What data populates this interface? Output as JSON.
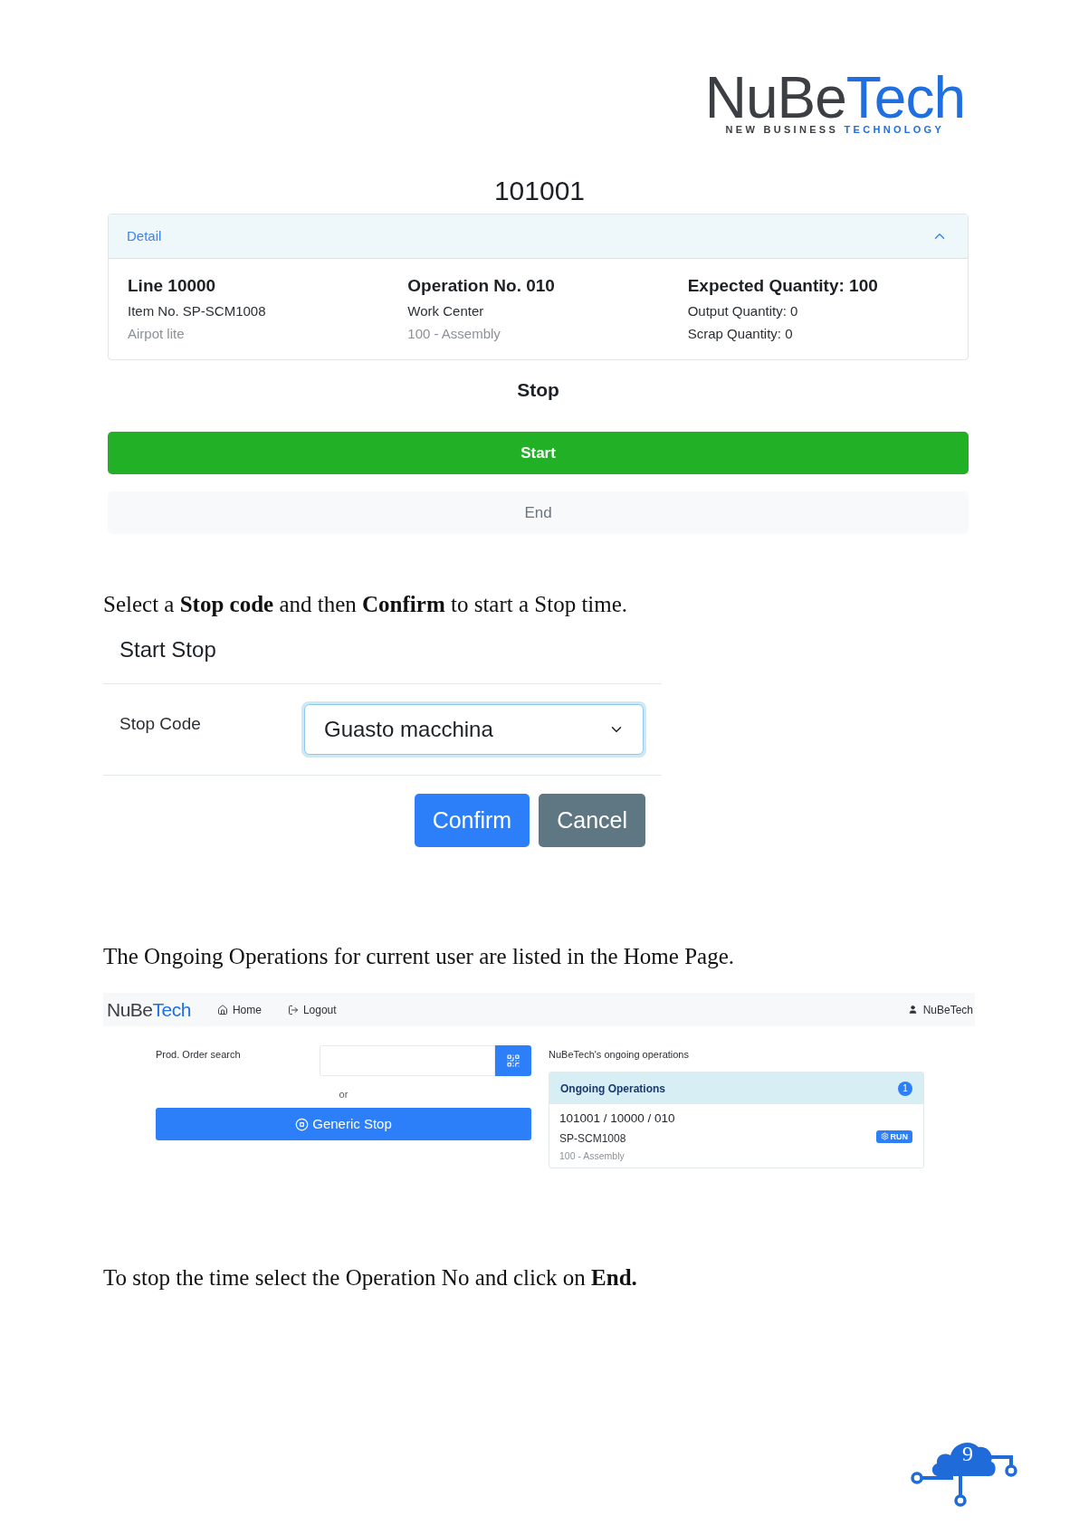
{
  "logo": {
    "name": [
      {
        "text": "NuBe",
        "accent": false
      },
      {
        "text": "Tech",
        "accent": true
      }
    ],
    "tagline": [
      {
        "text": "NEW BUSINESS",
        "accent": false
      },
      {
        "text": "TECHNOLOGY",
        "accent": true
      }
    ]
  },
  "order_number": "101001",
  "detail_panel": {
    "title": "Detail",
    "expanded": true,
    "columns": [
      {
        "heading": "Line 10000",
        "lines": [
          {
            "text": "Item No. SP-SCM1008",
            "muted": false
          },
          {
            "text": "Airpot lite",
            "muted": true
          }
        ]
      },
      {
        "heading": "Operation No. 010",
        "lines": [
          {
            "text": "Work Center",
            "muted": false
          },
          {
            "text": "100 - Assembly",
            "muted": true
          }
        ]
      },
      {
        "heading": "Expected Quantity: 100",
        "lines": [
          {
            "text": "Output Quantity: 0",
            "muted": false
          },
          {
            "text": "Scrap Quantity: 0",
            "muted": false
          }
        ]
      }
    ]
  },
  "stop_section": {
    "title": "Stop",
    "buttons": [
      {
        "label": "Start",
        "kind": "success"
      },
      {
        "label": "End",
        "kind": "light"
      }
    ]
  },
  "instruction_1": "Select a **Stop code** and then **Confirm** to start a Stop time.",
  "start_stop_dialog": {
    "title": "Start Stop",
    "field_label": "Stop Code",
    "select": {
      "value": "Guasto macchina",
      "focused": true
    },
    "buttons": [
      {
        "label": "Confirm",
        "kind": "primary"
      },
      {
        "label": "Cancel",
        "kind": "secondary"
      }
    ]
  },
  "instruction_2": "The Ongoing Operations for current user are listed in the Home Page.",
  "home_page": {
    "navbar": {
      "brand": [
        {
          "text": "NuBe",
          "accent": false
        },
        {
          "text": "Tech",
          "accent": true
        }
      ],
      "links": [
        {
          "label": "Home",
          "kind": "home"
        },
        {
          "label": "Logout",
          "kind": "logout"
        }
      ],
      "user": "NuBeTech"
    },
    "search": {
      "label": "Prod. Order search"
    },
    "or_text": "or",
    "generic_stop_button": "Generic Stop",
    "ongoing": {
      "caption": "NuBeTech's ongoing operations",
      "title": "Ongoing Operations",
      "count": "1",
      "items": [
        {
          "title": "101001 / 10000 / 010",
          "item_no": "SP-SCM1008",
          "work_center": "100 - Assembly",
          "status": "RUN"
        }
      ]
    }
  },
  "instruction_3": "To stop the time select the Operation No and click on **End.**",
  "page_number": "9"
}
